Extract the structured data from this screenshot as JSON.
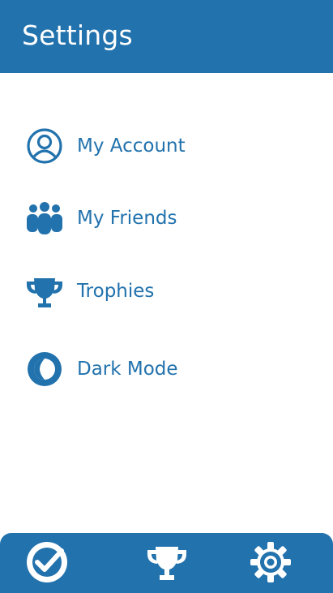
{
  "header": {
    "title": "Settings"
  },
  "menu": {
    "items": [
      {
        "label": "My Account",
        "icon": "user-circle-icon"
      },
      {
        "label": "My Friends",
        "icon": "users-group-icon"
      },
      {
        "label": "Trophies",
        "icon": "trophy-icon"
      },
      {
        "label": "Dark Mode",
        "icon": "dark-mode-icon"
      }
    ]
  },
  "bottom_nav": {
    "items": [
      {
        "icon": "check-circle-icon"
      },
      {
        "icon": "trophy-icon"
      },
      {
        "icon": "gear-icon"
      }
    ]
  },
  "colors": {
    "primary": "#2272ad",
    "background": "#ffffff",
    "header_text": "#ffffff"
  }
}
